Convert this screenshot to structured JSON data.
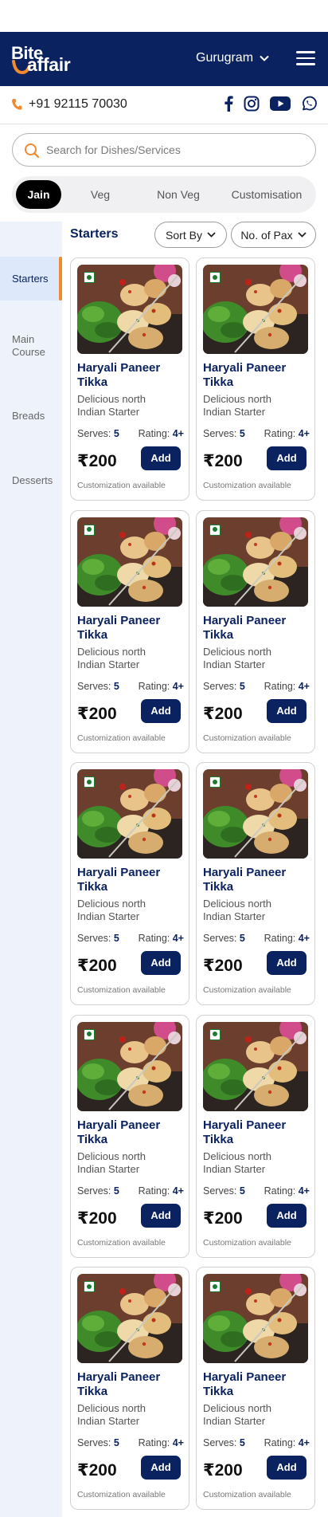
{
  "brand": {
    "part1": "Bite",
    "part2": "affair",
    "accent": "#f08a2e",
    "navy": "#0b2260"
  },
  "header": {
    "city": "Gurugram"
  },
  "contact": {
    "phone": "+91 92115 70030",
    "socials": [
      "facebook-icon",
      "instagram-icon",
      "youtube-icon",
      "whatsapp-icon"
    ]
  },
  "search": {
    "placeholder": "Search for Dishes/Services"
  },
  "diet_tabs": [
    "Jain",
    "Veg",
    "Non Veg",
    "Customisation"
  ],
  "active_diet_tab": "Jain",
  "categories": [
    "Starters",
    "Main Course",
    "Breads",
    "Desserts"
  ],
  "active_category": "Starters",
  "section": {
    "title": "Starters",
    "sort_label": "Sort By",
    "pax_label": "No. of Pax"
  },
  "products": [
    {
      "name": "Haryali Paneer Tikka",
      "desc": "Delicious north Indian Starter",
      "serves_label": "Serves:",
      "serves": "5",
      "rating_label": "Rating:",
      "rating": "4+",
      "price": "₹200",
      "add_label": "Add",
      "note": "Customization available"
    },
    {
      "name": "Haryali Paneer Tikka",
      "desc": "Delicious north Indian Starter",
      "serves_label": "Serves:",
      "serves": "5",
      "rating_label": "Rating:",
      "rating": "4+",
      "price": "₹200",
      "add_label": "Add",
      "note": "Customization available"
    },
    {
      "name": "Haryali Paneer Tikka",
      "desc": "Delicious north Indian Starter",
      "serves_label": "Serves:",
      "serves": "5",
      "rating_label": "Rating:",
      "rating": "4+",
      "price": "₹200",
      "add_label": "Add",
      "note": "Customization available"
    },
    {
      "name": "Haryali Paneer Tikka",
      "desc": "Delicious north Indian Starter",
      "serves_label": "Serves:",
      "serves": "5",
      "rating_label": "Rating:",
      "rating": "4+",
      "price": "₹200",
      "add_label": "Add",
      "note": "Customization available"
    },
    {
      "name": "Haryali Paneer Tikka",
      "desc": "Delicious north Indian Starter",
      "serves_label": "Serves:",
      "serves": "5",
      "rating_label": "Rating:",
      "rating": "4+",
      "price": "₹200",
      "add_label": "Add",
      "note": "Customization available"
    },
    {
      "name": "Haryali Paneer Tikka",
      "desc": "Delicious north Indian Starter",
      "serves_label": "Serves:",
      "serves": "5",
      "rating_label": "Rating:",
      "rating": "4+",
      "price": "₹200",
      "add_label": "Add",
      "note": "Customization available"
    },
    {
      "name": "Haryali Paneer Tikka",
      "desc": "Delicious north Indian Starter",
      "serves_label": "Serves:",
      "serves": "5",
      "rating_label": "Rating:",
      "rating": "4+",
      "price": "₹200",
      "add_label": "Add",
      "note": "Customization available"
    },
    {
      "name": "Haryali Paneer Tikka",
      "desc": "Delicious north Indian Starter",
      "serves_label": "Serves:",
      "serves": "5",
      "rating_label": "Rating:",
      "rating": "4+",
      "price": "₹200",
      "add_label": "Add",
      "note": "Customization available"
    },
    {
      "name": "Haryali Paneer Tikka",
      "desc": "Delicious north Indian Starter",
      "serves_label": "Serves:",
      "serves": "5",
      "rating_label": "Rating:",
      "rating": "4+",
      "price": "₹200",
      "add_label": "Add",
      "note": "Customization available"
    },
    {
      "name": "Haryali Paneer Tikka",
      "desc": "Delicious north Indian Starter",
      "serves_label": "Serves:",
      "serves": "5",
      "rating_label": "Rating:",
      "rating": "4+",
      "price": "₹200",
      "add_label": "Add",
      "note": "Customization available"
    }
  ]
}
